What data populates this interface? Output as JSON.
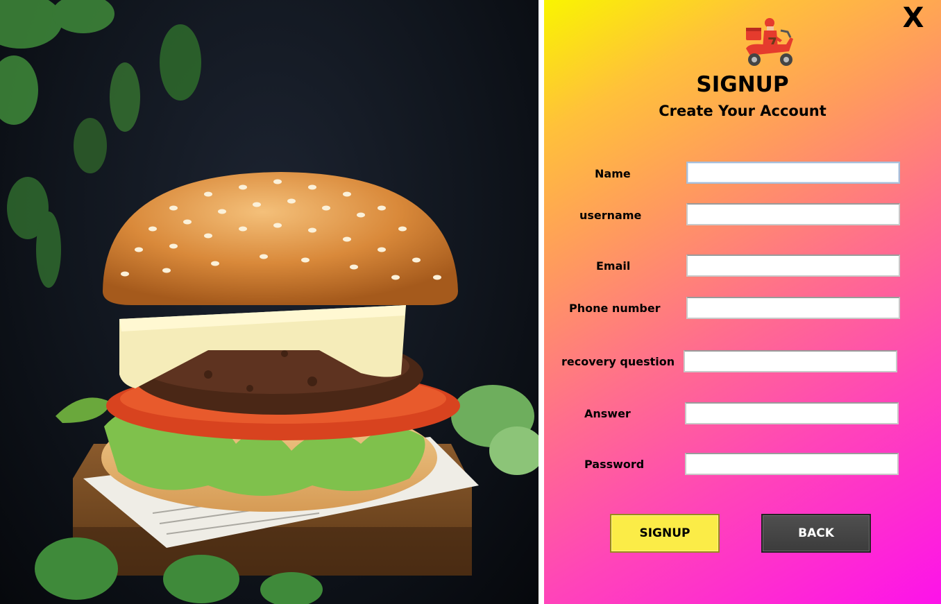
{
  "window": {
    "close_label": "X"
  },
  "form": {
    "title": "SIGNUP",
    "subtitle": "Create Your Account",
    "fields": [
      {
        "label": "Name",
        "value": ""
      },
      {
        "label": "username",
        "value": ""
      },
      {
        "label": "Email",
        "value": ""
      },
      {
        "label": "Phone number",
        "value": ""
      },
      {
        "label": "recovery question",
        "value": ""
      },
      {
        "label": "Answer",
        "value": ""
      },
      {
        "label": "Password",
        "value": ""
      }
    ],
    "signup_label": "SIGNUP",
    "back_label": "BACK"
  },
  "colors": {
    "gradient_start": "#f9f500",
    "gradient_end": "#fd12ea",
    "signup_button": "#fbec47",
    "back_button": "#444444"
  },
  "icons": {
    "logo": "delivery-scooter-icon",
    "close": "close-icon"
  },
  "image": {
    "subject": "burger-photo"
  }
}
